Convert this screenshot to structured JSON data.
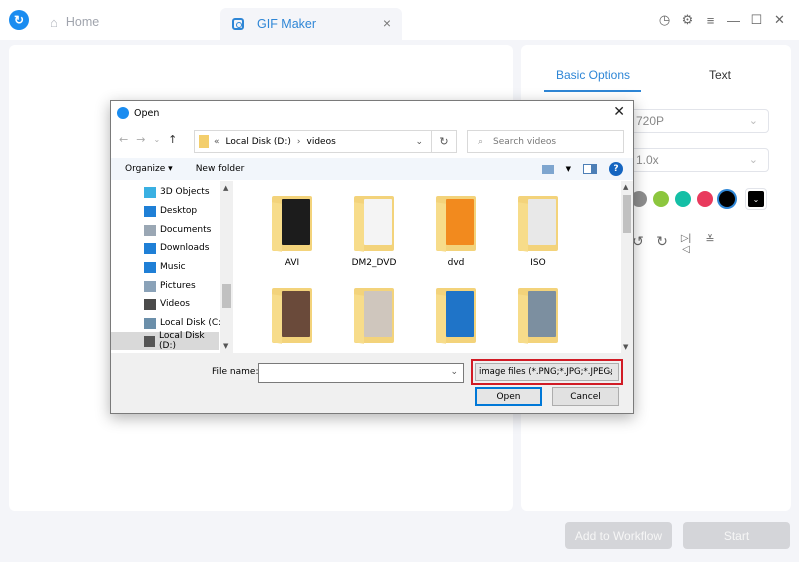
{
  "titlebar": {
    "tabs": [
      {
        "label": "Home",
        "icon": "home-icon",
        "active": false
      },
      {
        "label": "GIF Maker",
        "icon": "gif-icon",
        "active": true
      }
    ],
    "tab_close": "×",
    "controls": {
      "history": "◷",
      "settings": "⚙",
      "menu": "≡",
      "minimize": "—",
      "maximize": "☐",
      "close": "✕"
    }
  },
  "right_panel": {
    "tabs": [
      {
        "label": "Basic Options",
        "active": true
      },
      {
        "label": "Text",
        "active": false
      }
    ],
    "resolution": "720P",
    "speed": "1.0x",
    "colors": [
      "#8e8e8e",
      "#8cc63e",
      "#14bfa6",
      "#e93a5d",
      "#000000"
    ],
    "selected_color": "#000000",
    "color_picker_value": "#000000",
    "transforms": [
      "rotate-left",
      "rotate-right",
      "flip-horizontal",
      "flip-vertical"
    ]
  },
  "footer": {
    "add_to_workflow": "Add to Workflow",
    "start": "Start"
  },
  "dialog": {
    "title": "Open",
    "address": {
      "prefix": "«",
      "crumbs": [
        "Local Disk (D:)",
        "videos"
      ]
    },
    "search_placeholder": "Search videos",
    "toolbar": {
      "organize": "Organize ▾",
      "new_folder": "New folder"
    },
    "nav_items": [
      {
        "label": "3D Objects",
        "color": "#3ab0e2"
      },
      {
        "label": "Desktop",
        "color": "#1f7fd6"
      },
      {
        "label": "Documents",
        "color": "#9aa7b4"
      },
      {
        "label": "Downloads",
        "color": "#1f7fd6"
      },
      {
        "label": "Music",
        "color": "#1f7fd6"
      },
      {
        "label": "Pictures",
        "color": "#8aa2b8"
      },
      {
        "label": "Videos",
        "color": "#4b4b4b"
      },
      {
        "label": "Local Disk (C:)",
        "color": "#6b8faa"
      },
      {
        "label": "Local Disk (D:)",
        "color": "#555555",
        "selected": true
      }
    ],
    "folders": [
      {
        "label": "AVI",
        "thumb": "#1c1c1c"
      },
      {
        "label": "DM2_DVD",
        "thumb": "#f4f4f4"
      },
      {
        "label": "dvd",
        "thumb": "#f28a1e"
      },
      {
        "label": "ISO",
        "thumb": "#e8e8e8"
      },
      {
        "label": "",
        "thumb": "#6a4a3a"
      },
      {
        "label": "",
        "thumb": "#cfc6bd"
      },
      {
        "label": "",
        "thumb": "#1f74c8"
      },
      {
        "label": "",
        "thumb": "#7c8fa0"
      }
    ],
    "file_name_label": "File name:",
    "file_name_value": "",
    "file_type": "image files (*.PNG;*.JPG;*.JPEG;",
    "open": "Open",
    "cancel": "Cancel"
  }
}
